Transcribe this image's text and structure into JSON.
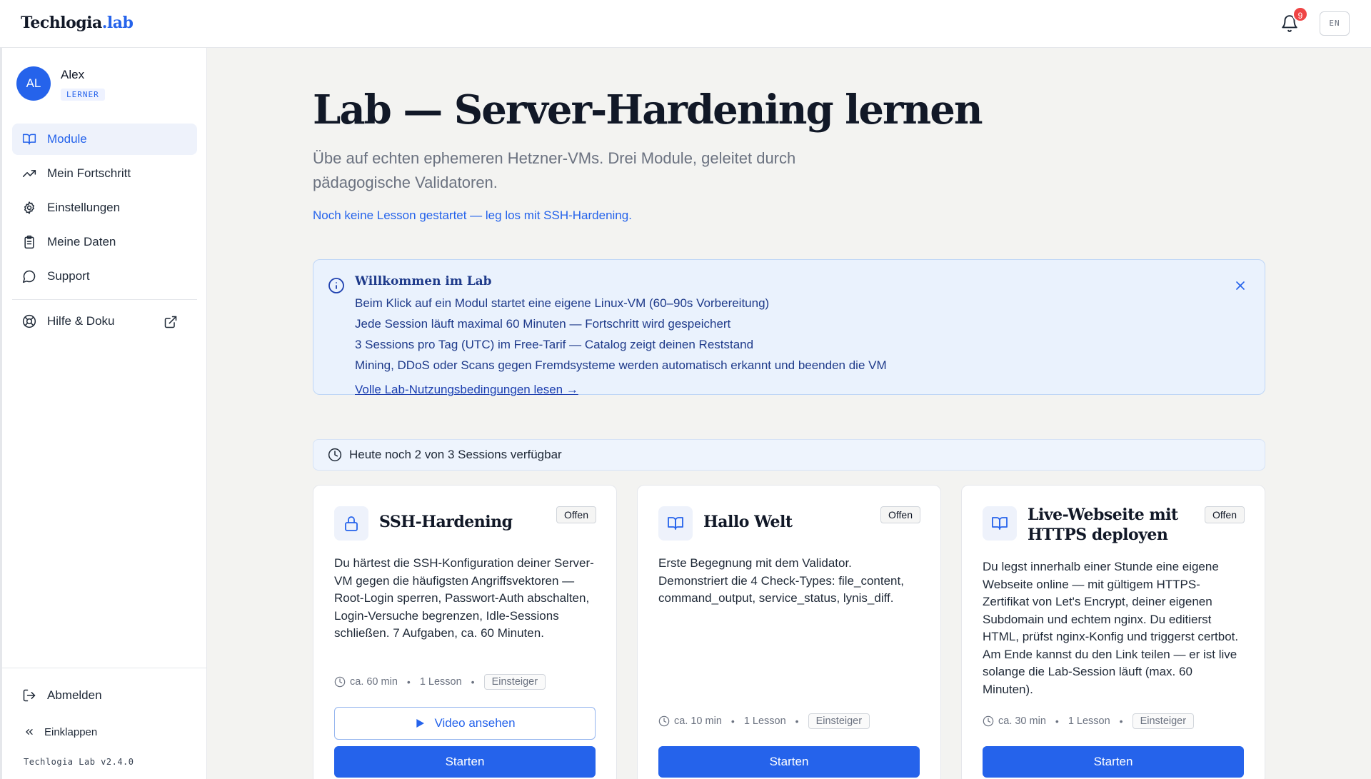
{
  "brand": {
    "name": "Techlogia",
    "suffix": ".lab"
  },
  "header": {
    "notifications_count": "9",
    "language": "EN"
  },
  "user": {
    "initials": "AL",
    "name": "Alex",
    "role": "LERNER"
  },
  "sidebar": {
    "items": [
      {
        "label": "Module",
        "icon": "book-open-icon",
        "active": true
      },
      {
        "label": "Mein Fortschritt",
        "icon": "trending-up-icon"
      },
      {
        "label": "Einstellungen",
        "icon": "gear-icon"
      },
      {
        "label": "Meine Daten",
        "icon": "clipboard-icon"
      },
      {
        "label": "Support",
        "icon": "message-circle-icon"
      }
    ],
    "help": {
      "label": "Hilfe & Doku",
      "icon": "life-buoy-icon"
    },
    "logout_label": "Abmelden",
    "collapse_label": "Einklappen",
    "version": "Techlogia Lab v2.4.0"
  },
  "main": {
    "title": "Lab — Server-Hardening lernen",
    "subtitle": "Übe auf echten ephemeren Hetzner-VMs. Drei Module, geleitet durch pädagogische Validatoren.",
    "start_link": "Noch keine Lesson gestartet — leg los mit SSH-Hardening.",
    "welcome": {
      "title": "Willkommen im Lab",
      "lines": [
        "Beim Klick auf ein Modul startet eine eigene Linux-VM (60–90s Vorbereitung)",
        "Jede Session läuft maximal 60 Minuten — Fortschritt wird gespeichert",
        "3 Sessions pro Tag (UTC) im Free-Tarif — Catalog zeigt deinen Reststand",
        "Mining, DDoS oder Scans gegen Fremdsysteme werden automatisch erkannt und beenden die VM"
      ],
      "link": "Volle Lab-Nutzungsbedingungen lesen →"
    },
    "sessions_text": "Heute noch 2 von 3 Sessions verfügbar",
    "cards": [
      {
        "title": "SSH-Hardening",
        "badge": "Offen",
        "icon": "lock-icon",
        "description": "Du härtest die SSH-Konfiguration deiner Server-VM gegen die häufigsten Angriffsvektoren — Root-Login sperren, Passwort-Auth abschalten, Login-Versuche begrenzen, Idle-Sessions schließen. 7 Aufgaben, ca. 60 Minuten.",
        "duration": "ca. 60 min",
        "lessons": "1 Lesson",
        "level": "Einsteiger",
        "video_label": "Video ansehen",
        "start_label": "Starten"
      },
      {
        "title": "Hallo Welt",
        "badge": "Offen",
        "icon": "book-open-icon",
        "description": "Erste Begegnung mit dem Validator. Demonstriert die 4 Check-Types: file_content, command_output, service_status, lynis_diff.",
        "duration": "ca. 10 min",
        "lessons": "1 Lesson",
        "level": "Einsteiger",
        "start_label": "Starten"
      },
      {
        "title": "Live-Webseite mit HTTPS deployen",
        "badge": "Offen",
        "icon": "book-open-icon",
        "description": "Du legst innerhalb einer Stunde eine eigene Webseite online — mit gültigem HTTPS-Zertifikat von Let's Encrypt, deiner eigenen Subdomain und echtem nginx. Du editierst HTML, prüfst nginx-Konfig und triggerst certbot. Am Ende kannst du den Link teilen — er ist live solange die Lab-Session läuft (max. 60 Minuten).",
        "duration": "ca. 30 min",
        "lessons": "1 Lesson",
        "level": "Einsteiger",
        "start_label": "Starten"
      }
    ]
  },
  "colors": {
    "accent": "#2563eb",
    "badge_red": "#ef4444",
    "info_bg": "#eaf2fd",
    "page_bg": "#f3f3f1"
  }
}
